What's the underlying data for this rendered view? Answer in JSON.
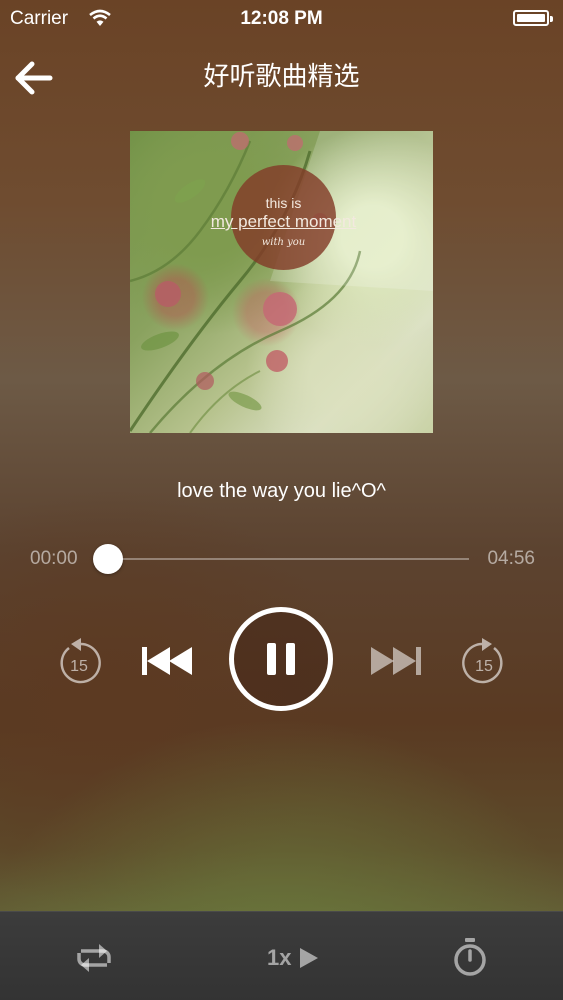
{
  "status_bar": {
    "carrier": "Carrier",
    "time": "12:08 PM",
    "wifi_icon": "wifi-icon",
    "battery_icon": "battery-icon",
    "battery_level": 1.0
  },
  "nav": {
    "back_icon": "arrow-left-icon",
    "title": "好听歌曲精选"
  },
  "album": {
    "line1": "this is",
    "line2": "my perfect moment",
    "line3": "with you"
  },
  "track": {
    "title": "love the way you lie^O^",
    "elapsed": "00:00",
    "duration": "04:56",
    "progress": 0.0
  },
  "controls": {
    "rewind_label": "15",
    "forward_label": "15",
    "rewind_icon": "rewind-15-icon",
    "prev_icon": "skip-previous-icon",
    "pause_icon": "pause-icon",
    "next_icon": "skip-next-icon",
    "forward_icon": "forward-15-icon"
  },
  "bottom_bar": {
    "repeat_icon": "repeat-icon",
    "speed_label": "1x",
    "speed_icon": "play-arrow-icon",
    "timer_icon": "stopwatch-icon"
  },
  "colors": {
    "text": "#ffffff",
    "muted": "#b0a89f",
    "bottom_bar": "#383838"
  }
}
